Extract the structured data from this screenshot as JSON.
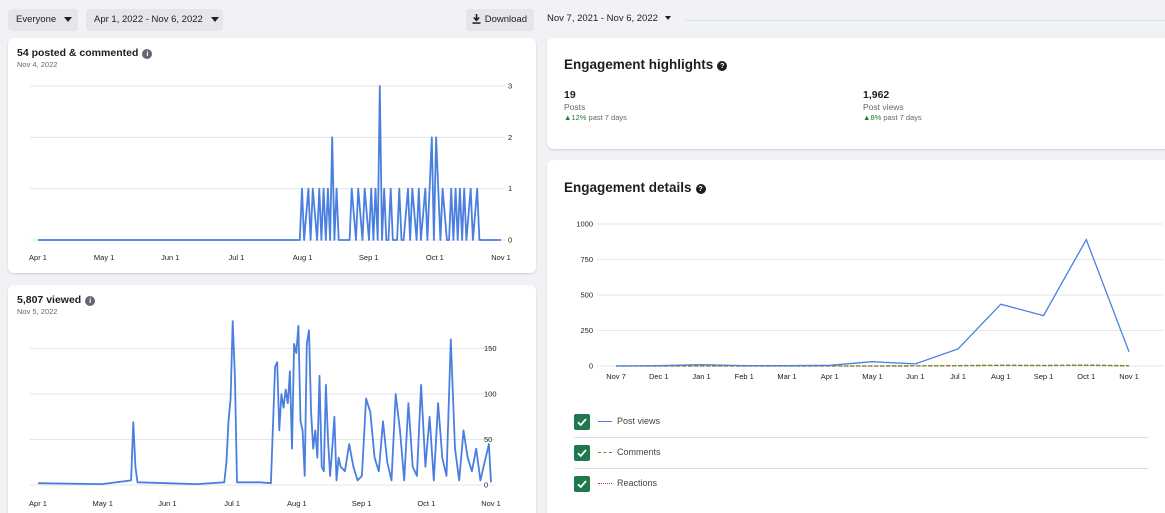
{
  "left_panel": {
    "toolbar": {
      "audience": "Everyone",
      "date_range": "Apr 1, 2022 - Nov 6, 2022",
      "download_label": "Download"
    },
    "posted_card": {
      "title": "54 posted & commented",
      "subtitle": "Nov 4, 2022"
    },
    "viewed_card": {
      "title": "5,807 viewed",
      "subtitle": "Nov 5, 2022"
    }
  },
  "right_panel": {
    "date_range": "Nov 7, 2021 - Nov 6, 2022",
    "highlights": {
      "title": "Engagement highlights",
      "metrics": [
        {
          "value": "19",
          "label": "Posts",
          "change_arrow": "▲",
          "change_value": "12%",
          "change_text": "past 7 days"
        },
        {
          "value": "1,962",
          "label": "Post views",
          "change_arrow": "▲",
          "change_value": "8%",
          "change_text": "past 7 days"
        }
      ]
    },
    "details": {
      "title": "Engagement details",
      "legend": [
        {
          "name": "Post views",
          "color": "#4a7fe0",
          "style": "solid"
        },
        {
          "name": "Comments",
          "color": "#6b8e23",
          "style": "dashed"
        },
        {
          "name": "Reactions",
          "color": "#c0392b",
          "style": "dotted"
        }
      ]
    }
  },
  "chart_data": [
    {
      "type": "line",
      "name": "posted & commented",
      "x_ticks": [
        "Apr 1",
        "May 1",
        "Jun 1",
        "Jul 1",
        "Aug 1",
        "Sep 1",
        "Oct 1",
        "Nov 1"
      ],
      "y_ticks": [
        "0",
        "1",
        "2",
        "3"
      ],
      "ylim": [
        0,
        3
      ],
      "color": "#4a7fe0",
      "grid": true,
      "x_domain": [
        "2022-04-01",
        "2022-11-01"
      ],
      "x": [
        "2022-04-01",
        "2022-07-31",
        "2022-08-01",
        "2022-08-02",
        "2022-08-04",
        "2022-08-05",
        "2022-08-06",
        "2022-08-08",
        "2022-08-09",
        "2022-08-10",
        "2022-08-11",
        "2022-08-12",
        "2022-08-13",
        "2022-08-14",
        "2022-08-15",
        "2022-08-16",
        "2022-08-17",
        "2022-08-18",
        "2022-08-19",
        "2022-08-20",
        "2022-08-21",
        "2022-08-23",
        "2022-08-24",
        "2022-08-26",
        "2022-08-27",
        "2022-08-29",
        "2022-08-30",
        "2022-09-01",
        "2022-09-02",
        "2022-09-03",
        "2022-09-04",
        "2022-09-05",
        "2022-09-06",
        "2022-09-07",
        "2022-09-08",
        "2022-09-09",
        "2022-09-10",
        "2022-09-11",
        "2022-09-12",
        "2022-09-14",
        "2022-09-15",
        "2022-09-16",
        "2022-09-17",
        "2022-09-19",
        "2022-09-20",
        "2022-09-21",
        "2022-09-23",
        "2022-09-24",
        "2022-09-25",
        "2022-09-27",
        "2022-09-28",
        "2022-09-30",
        "2022-10-01",
        "2022-10-02",
        "2022-10-04",
        "2022-10-05",
        "2022-10-07",
        "2022-10-08",
        "2022-10-09",
        "2022-10-10",
        "2022-10-11",
        "2022-10-12",
        "2022-10-13",
        "2022-10-14",
        "2022-10-15",
        "2022-10-16",
        "2022-10-18",
        "2022-10-19",
        "2022-10-21",
        "2022-10-22",
        "2022-10-23",
        "2022-10-25",
        "2022-10-26",
        "2022-10-27",
        "2022-10-29",
        "2022-10-30",
        "2022-10-31",
        "2022-11-01"
      ],
      "y": [
        0,
        0,
        1,
        0,
        1,
        0,
        1,
        0,
        1,
        0,
        1,
        0,
        1,
        0,
        2,
        0,
        1,
        0,
        0,
        0,
        0,
        0,
        1,
        0,
        1,
        0,
        1,
        0,
        1,
        0,
        1,
        0,
        3,
        0,
        1,
        0,
        0,
        1,
        0,
        0,
        1,
        0,
        0,
        1,
        0,
        1,
        0,
        1,
        0,
        1,
        0,
        2,
        0,
        2,
        0,
        1,
        0,
        0,
        1,
        0,
        1,
        0,
        1,
        0,
        1,
        0,
        1,
        0,
        1,
        0,
        0,
        0,
        0,
        0,
        0,
        0,
        0,
        0
      ]
    },
    {
      "type": "line",
      "name": "viewed",
      "x_ticks": [
        "Apr 1",
        "May 1",
        "Jun 1",
        "Jul 1",
        "Aug 1",
        "Sep 1",
        "Oct 1",
        "Nov 1"
      ],
      "y_ticks": [
        "0",
        "50",
        "100",
        "150"
      ],
      "ylim": [
        0,
        200
      ],
      "color": "#4a7fe0",
      "grid": true,
      "x_domain": [
        "2022-04-01",
        "2022-11-01"
      ],
      "x": [
        "2022-04-01",
        "2022-05-01",
        "2022-05-15",
        "2022-05-16",
        "2022-05-17",
        "2022-05-18",
        "2022-06-01",
        "2022-06-15",
        "2022-06-28",
        "2022-06-29",
        "2022-06-30",
        "2022-07-01",
        "2022-07-02",
        "2022-07-03",
        "2022-07-04",
        "2022-07-15",
        "2022-07-20",
        "2022-07-22",
        "2022-07-23",
        "2022-07-24",
        "2022-07-25",
        "2022-07-26",
        "2022-07-27",
        "2022-07-28",
        "2022-07-29",
        "2022-07-30",
        "2022-07-31",
        "2022-08-01",
        "2022-08-02",
        "2022-08-03",
        "2022-08-04",
        "2022-08-05",
        "2022-08-06",
        "2022-08-07",
        "2022-08-08",
        "2022-08-09",
        "2022-08-10",
        "2022-08-11",
        "2022-08-12",
        "2022-08-13",
        "2022-08-14",
        "2022-08-15",
        "2022-08-16",
        "2022-08-17",
        "2022-08-18",
        "2022-08-19",
        "2022-08-20",
        "2022-08-21",
        "2022-08-22",
        "2022-08-24",
        "2022-08-26",
        "2022-08-28",
        "2022-08-30",
        "2022-09-01",
        "2022-09-03",
        "2022-09-05",
        "2022-09-07",
        "2022-09-09",
        "2022-09-11",
        "2022-09-13",
        "2022-09-15",
        "2022-09-17",
        "2022-09-19",
        "2022-09-21",
        "2022-09-23",
        "2022-09-25",
        "2022-09-27",
        "2022-09-29",
        "2022-10-01",
        "2022-10-03",
        "2022-10-05",
        "2022-10-07",
        "2022-10-09",
        "2022-10-11",
        "2022-10-13",
        "2022-10-15",
        "2022-10-17",
        "2022-10-19",
        "2022-10-21",
        "2022-10-23",
        "2022-10-25",
        "2022-10-27",
        "2022-10-29",
        "2022-10-31",
        "2022-11-01"
      ],
      "y": [
        2,
        1,
        5,
        69,
        20,
        3,
        2,
        1,
        3,
        25,
        70,
        95,
        180,
        120,
        3,
        3,
        2,
        130,
        135,
        60,
        100,
        85,
        105,
        90,
        125,
        40,
        155,
        145,
        175,
        70,
        60,
        10,
        155,
        170,
        80,
        40,
        60,
        30,
        120,
        20,
        15,
        110,
        50,
        10,
        40,
        75,
        5,
        30,
        20,
        15,
        45,
        20,
        5,
        10,
        95,
        80,
        30,
        15,
        70,
        25,
        5,
        100,
        60,
        5,
        90,
        20,
        10,
        110,
        20,
        75,
        5,
        90,
        30,
        10,
        160,
        40,
        5,
        60,
        30,
        15,
        40,
        5,
        25,
        45,
        3
      ]
    },
    {
      "type": "line",
      "name": "engagement details",
      "categories": [
        "Nov 7",
        "Dec 1",
        "Jan 1",
        "Feb 1",
        "Mar 1",
        "Apr 1",
        "May 1",
        "Jun 1",
        "Jul 1",
        "Aug 1",
        "Sep 1",
        "Oct 1",
        "Nov 1"
      ],
      "y_ticks": [
        "0",
        "250",
        "500",
        "750",
        "1000"
      ],
      "ylim": [
        0,
        1000
      ],
      "series": [
        {
          "name": "Post views",
          "style": "solid",
          "color": "#4a7fe0",
          "values": [
            0,
            2,
            10,
            3,
            2,
            5,
            30,
            15,
            120,
            435,
            355,
            890,
            100
          ]
        },
        {
          "name": "Comments",
          "style": "dashed",
          "color": "#6b8e23",
          "values": [
            0,
            0,
            0,
            0,
            0,
            0,
            0,
            1,
            3,
            5,
            4,
            6,
            2
          ]
        },
        {
          "name": "Reactions",
          "style": "dotted",
          "color": "#c0392b",
          "values": [
            0,
            0,
            0,
            0,
            0,
            0,
            0,
            1,
            2,
            4,
            3,
            5,
            1
          ]
        }
      ]
    }
  ]
}
